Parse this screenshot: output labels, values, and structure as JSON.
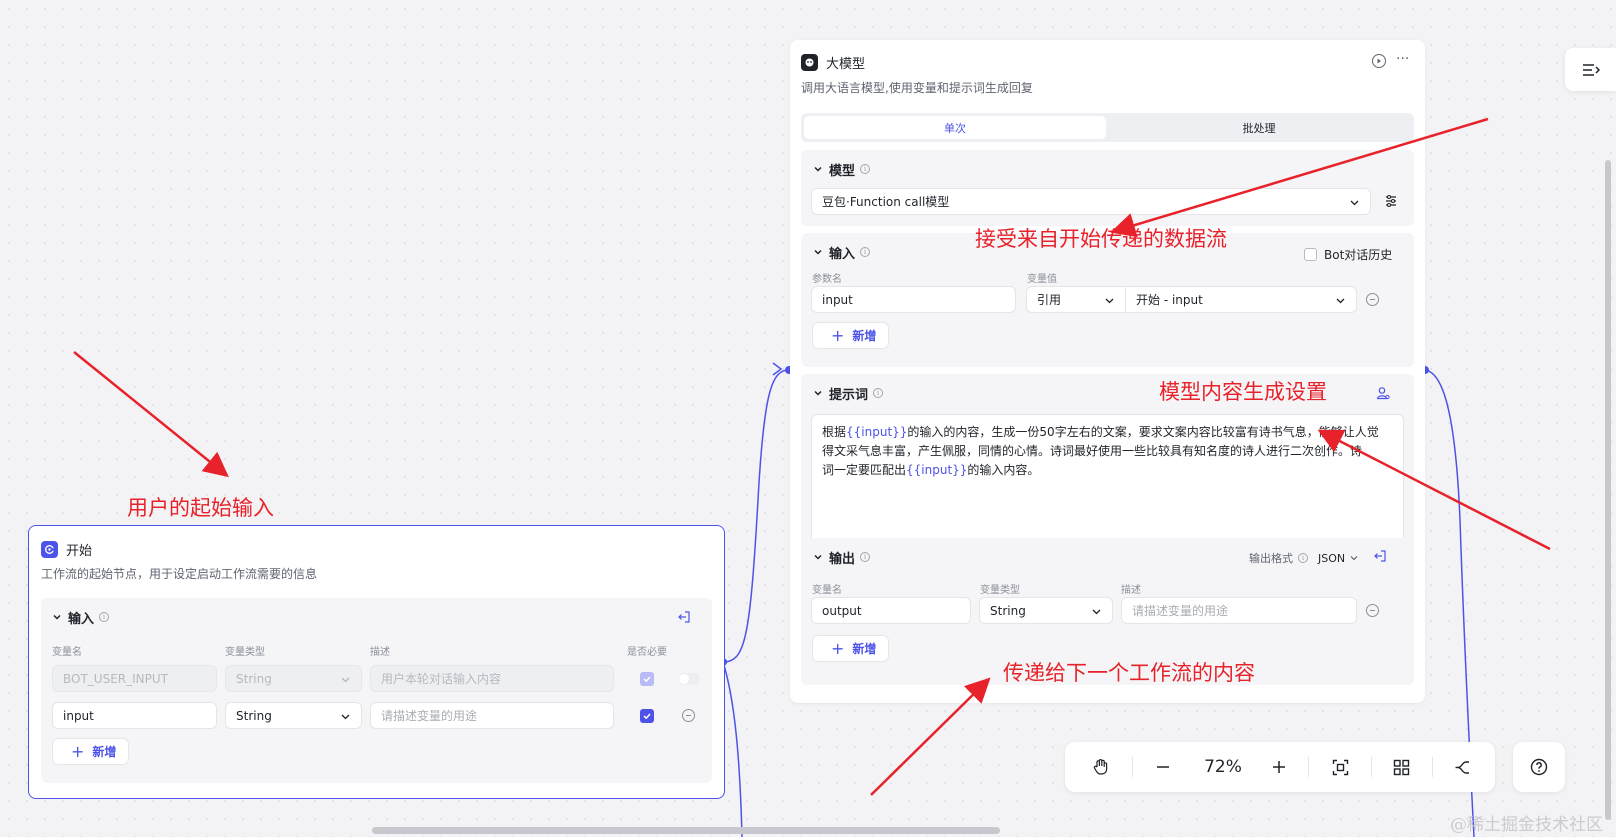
{
  "llm_node": {
    "title": "大模型",
    "description": "调用大语言模型,使用变量和提示词生成回复",
    "tabs": [
      "单次",
      "批处理"
    ],
    "model_section": {
      "title": "模型",
      "selected_model": "豆包·Function call模型"
    },
    "input_section": {
      "title": "输入",
      "bot_history_label": "Bot对话历史",
      "col_param": "参数名",
      "col_value": "变量值",
      "param_name": "input",
      "ref_type": "引用",
      "ref_value": "开始 - input",
      "add_label": "新增"
    },
    "prompt_section": {
      "title": "提示词",
      "text_1": "根据",
      "var": "{{input}}",
      "text_2": "的输入的内容，生成一份50字左右的文案，要求文案内容比较富有诗书气息，能够让人觉",
      "text_3": "得文采气息丰富，产生佩服，同情的心情。诗词最好使用一些比较具有知名度的诗人进行二次创作。诗",
      "text_4": "词一定要匹配出",
      "text_5": "的输入内容。"
    },
    "output_section": {
      "title": "输出",
      "format_label": "输出格式",
      "format_value": "JSON",
      "col_name": "变量名",
      "col_type": "变量类型",
      "col_desc": "描述",
      "var_name": "output",
      "var_type": "String",
      "desc_placeholder": "请描述变量的用途",
      "add_label": "新增"
    }
  },
  "start_node": {
    "title": "开始",
    "description": "工作流的起始节点，用于设定启动工作流需要的信息",
    "input_section": {
      "title": "输入",
      "col_name": "变量名",
      "col_type": "变量类型",
      "col_desc": "描述",
      "col_required": "是否必要",
      "rows": [
        {
          "name": "BOT_USER_INPUT",
          "type": "String",
          "desc": "用户本轮对话输入内容"
        },
        {
          "name": "input",
          "type": "String",
          "desc": "请描述变量的用途"
        }
      ],
      "add_label": "新增"
    }
  },
  "annotations": {
    "receive": "接受来自开始传递的数据流",
    "model_setting": "模型内容生成设置",
    "user_input": "用户的起始输入",
    "pass_next": "传递给下一个工作流的内容"
  },
  "toolbar": {
    "zoom": "72%"
  },
  "watermark": "@稀土掘金技术社区",
  "colors": {
    "accent": "#4d53e8",
    "annotation": "#e8222b",
    "edge": "#4d53e8"
  }
}
